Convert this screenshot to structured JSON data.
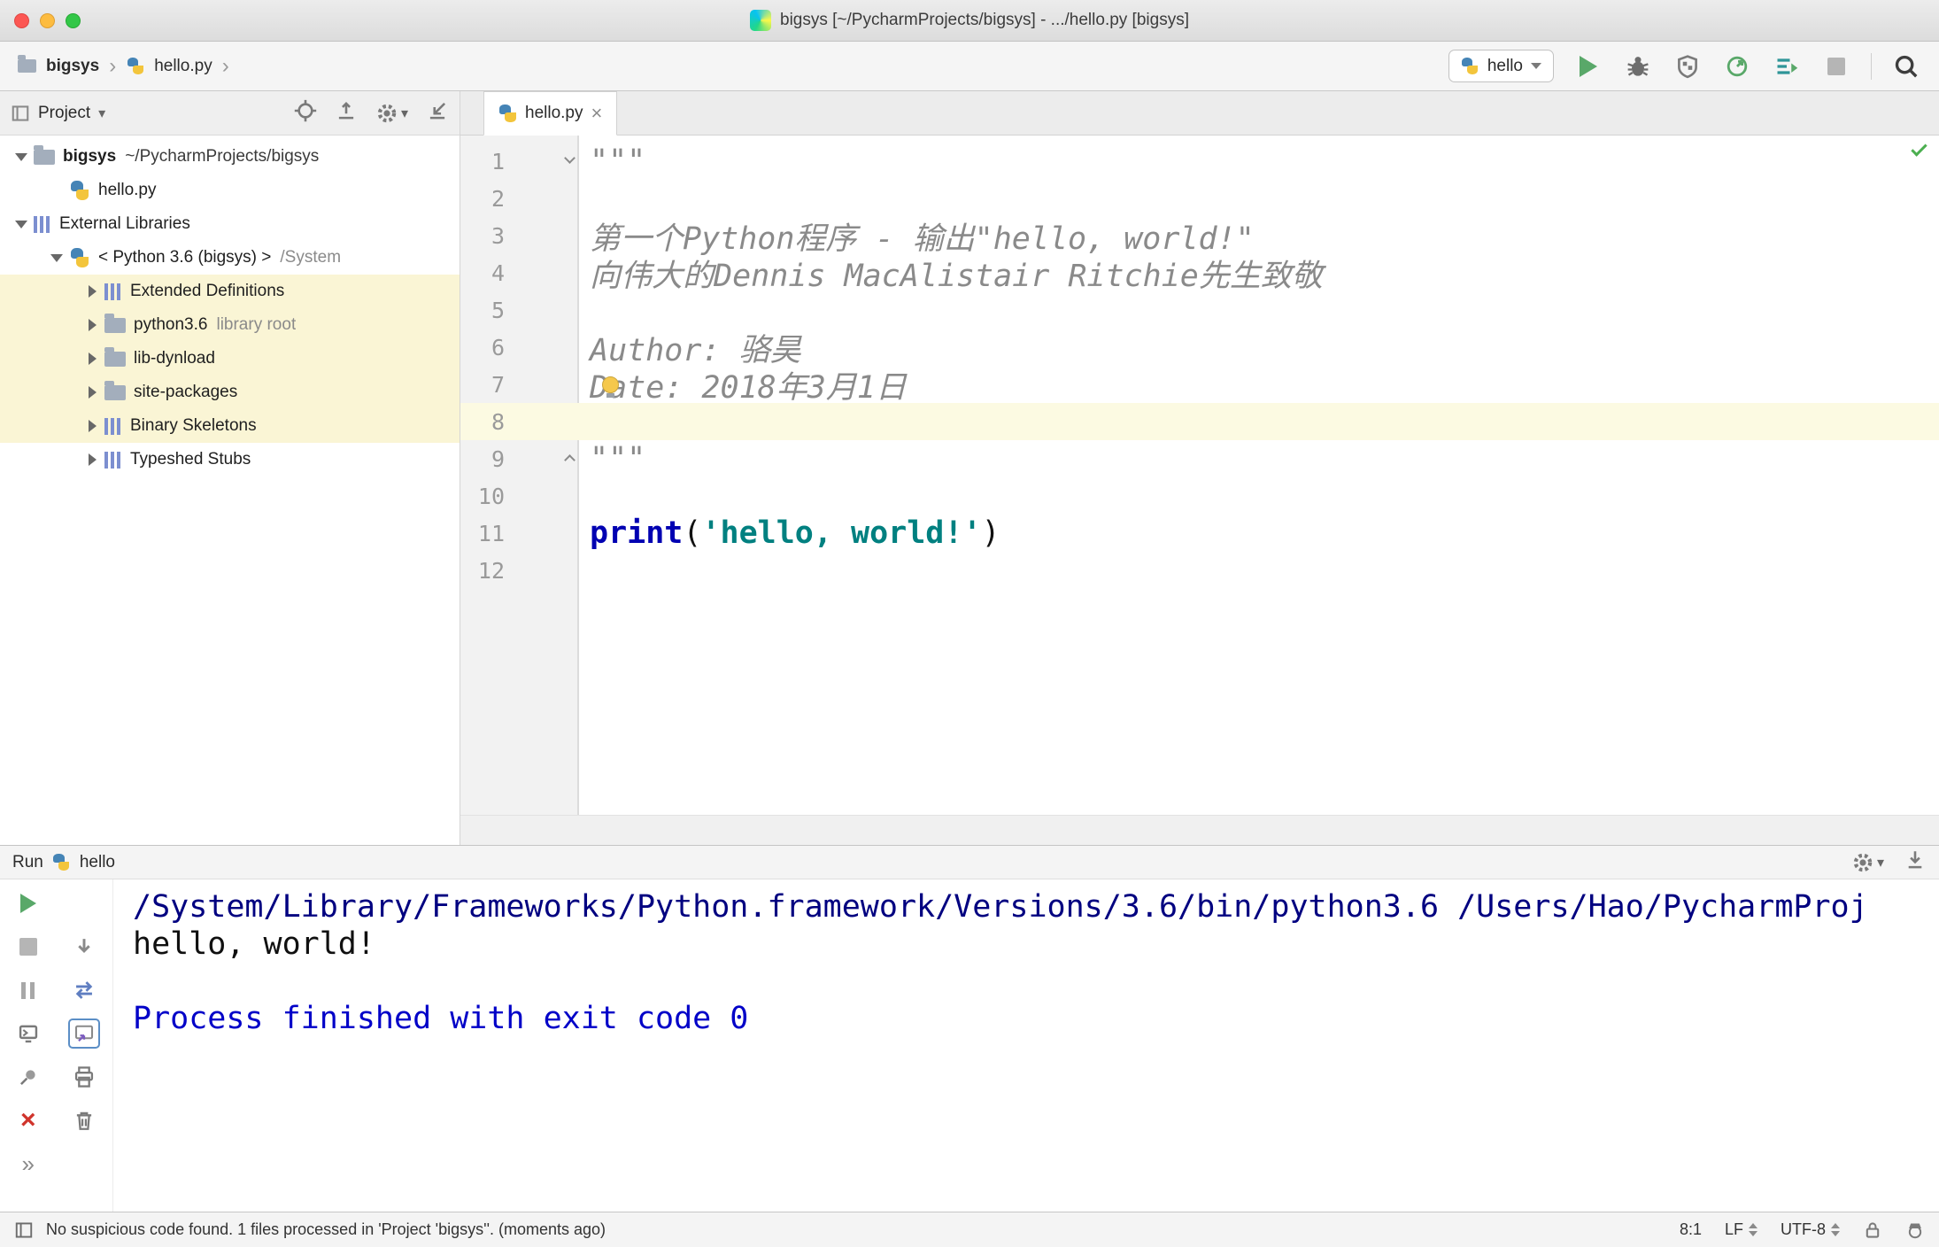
{
  "window": {
    "title": "bigsys [~/PycharmProjects/bigsys] - .../hello.py [bigsys]"
  },
  "navbar": {
    "breadcrumbs": [
      "bigsys",
      "hello.py"
    ],
    "run_config": "hello"
  },
  "project_panel": {
    "title": "Project",
    "tree": [
      {
        "name": "bigsys",
        "suffix": "~/PycharmProjects/bigsys"
      },
      {
        "name": "hello.py",
        "suffix": ""
      },
      {
        "name": "External Libraries",
        "suffix": ""
      },
      {
        "name": "< Python 3.6 (bigsys) >",
        "suffix": "/System"
      },
      {
        "name": "Extended Definitions",
        "suffix": ""
      },
      {
        "name": "python3.6",
        "suffix": "library root"
      },
      {
        "name": "lib-dynload",
        "suffix": ""
      },
      {
        "name": "site-packages",
        "suffix": ""
      },
      {
        "name": "Binary Skeletons",
        "suffix": ""
      },
      {
        "name": "Typeshed Stubs",
        "suffix": ""
      }
    ]
  },
  "editor": {
    "tab": "hello.py",
    "lines": [
      {
        "n": 1,
        "s0": "\"\"\""
      },
      {
        "n": 2
      },
      {
        "n": 3,
        "s0": "第一个Python程序 - 输出\"hello, world!\""
      },
      {
        "n": 4,
        "s0": "向伟大的Dennis MacAlistair Ritchie先生致敬"
      },
      {
        "n": 5
      },
      {
        "n": 6,
        "s0": "Author: 骆昊"
      },
      {
        "n": 7,
        "s0": "Date: 2018年3月1日"
      },
      {
        "n": 8
      },
      {
        "n": 9,
        "s0": "\"\"\""
      },
      {
        "n": 10
      },
      {
        "n": 11,
        "func": "print",
        "p1": "(",
        "str": "'hello, world!'",
        "p2": ")"
      },
      {
        "n": 12
      }
    ]
  },
  "run_panel": {
    "title": "Run",
    "config": "hello",
    "console": [
      "/System/Library/Frameworks/Python.framework/Versions/3.6/bin/python3.6 /Users/Hao/PycharmProj",
      "hello, world!",
      "",
      "Process finished with exit code 0"
    ]
  },
  "status_bar": {
    "message": "No suspicious code found. 1 files processed in 'Project 'bigsys''. (moments ago)",
    "caret_position": "8:1",
    "line_separator": "LF",
    "encoding": "UTF-8"
  },
  "colors": {
    "tree_highlight": "#faf5d5",
    "current_line": "#fcfae2",
    "docstring": "#8a8a8a",
    "function_call": "#0000b2",
    "string": "#008080",
    "console_command": "#000080",
    "console_info": "#0000c8",
    "run_green": "#59a869",
    "error_red": "#d0342c"
  }
}
